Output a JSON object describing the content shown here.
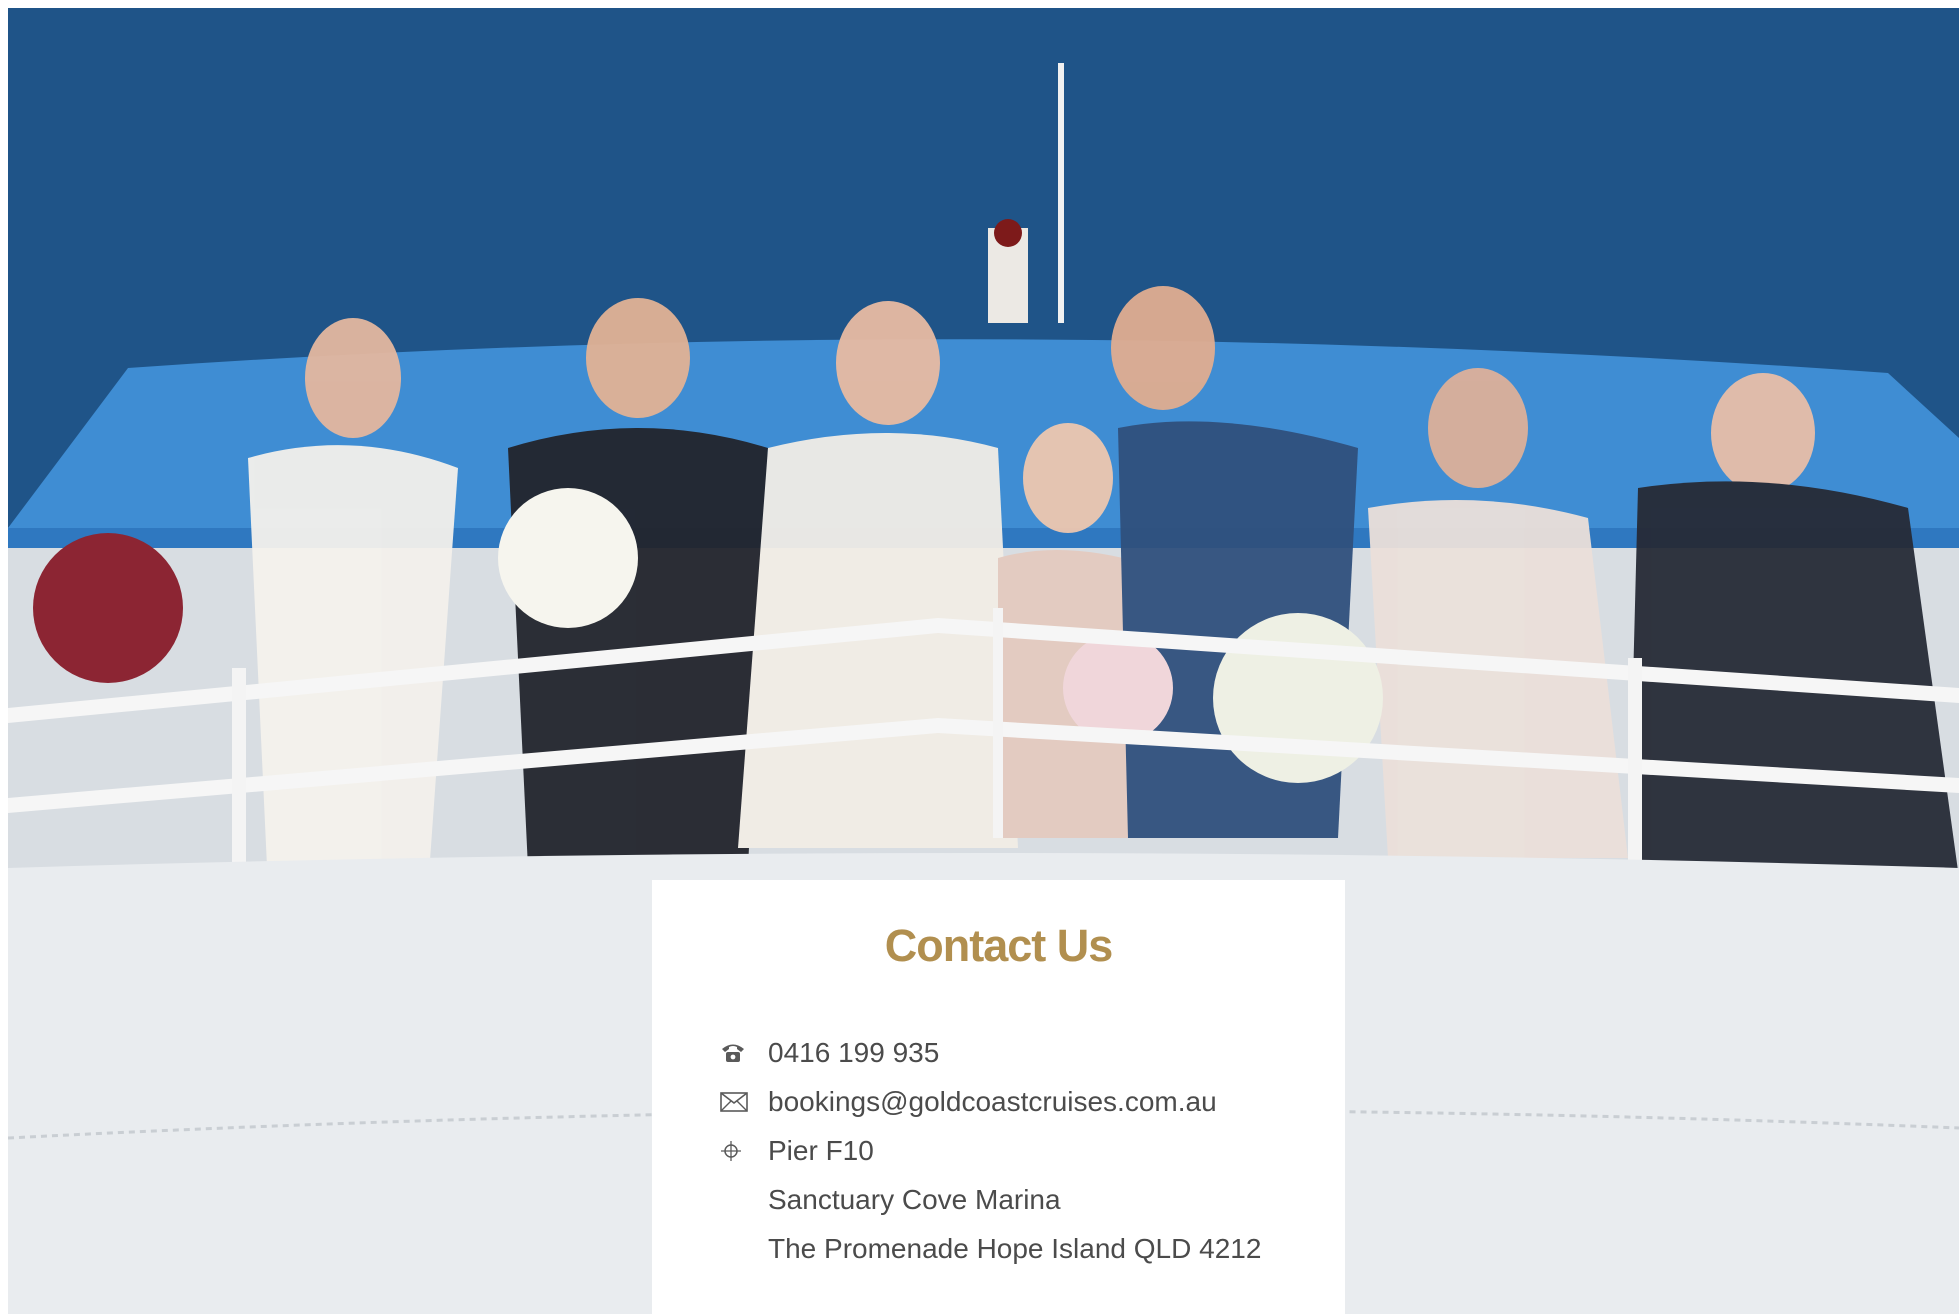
{
  "hero": {
    "image_description_icon": "wedding-party-on-boat-photo",
    "colors": {
      "sky": "#1f5187",
      "boat_blue": "#3f8ad0",
      "hull_white": "#eef1f4"
    }
  },
  "contact": {
    "title": "Contact Us",
    "title_color": "#b18f4f",
    "phone_icon": "phone-icon",
    "phone": "0416 199 935",
    "email_icon": "envelope-icon",
    "email": "bookings@goldcoastcruises.com.au",
    "location_icon": "location-icon",
    "address_line1": "Pier F10",
    "address_line2": "Sanctuary Cove Marina",
    "address_line3": "The Promenade Hope Island QLD 4212"
  }
}
